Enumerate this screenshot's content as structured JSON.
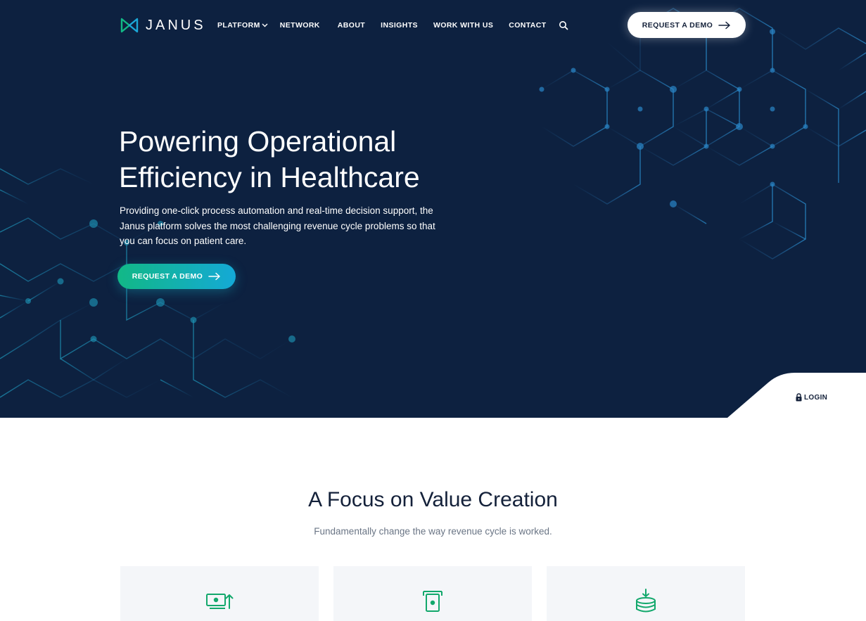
{
  "brand": {
    "name": "JANUS",
    "logo_icon": "janus-logo-icon",
    "accent": "#12b886",
    "navy": "#0d2140"
  },
  "nav": {
    "items": [
      {
        "label": "PLATFORM",
        "has_dropdown": true
      },
      {
        "label": "NETWORK"
      },
      {
        "label": "ABOUT"
      },
      {
        "label": "INSIGHTS"
      },
      {
        "label": "WORK WITH US"
      },
      {
        "label": "CONTACT"
      }
    ],
    "search_icon": "search-icon",
    "cta_label": "REQUEST A DEMO"
  },
  "hero": {
    "title_line1": "Powering Operational",
    "title_line2": "Efficiency in Healthcare",
    "description": "Providing one-click process automation and real-time decision support, the Janus platform solves the most challenging revenue cycle problems so that you can focus on patient care.",
    "cta_label": "REQUEST A DEMO"
  },
  "login": {
    "label": "LOGIN",
    "icon": "lock-icon"
  },
  "value_section": {
    "title": "A Focus on Value Creation",
    "subtitle": "Fundamentally change the way revenue cycle is worked.",
    "cards": [
      {
        "icon": "money-upload-icon"
      },
      {
        "icon": "cash-withdraw-icon"
      },
      {
        "icon": "coin-stack-download-icon"
      }
    ]
  }
}
